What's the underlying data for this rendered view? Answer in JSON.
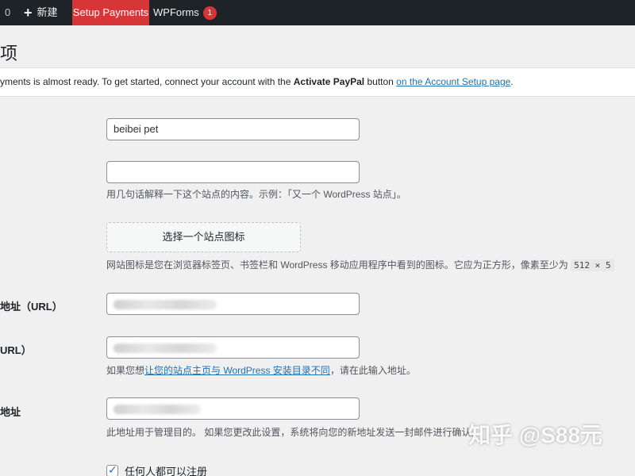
{
  "admin_bar": {
    "comment_count": "0",
    "new_label": "新建",
    "setup_payments_label": "Setup Payments",
    "wpforms_label": "WPForms",
    "wpforms_badge": "1"
  },
  "page": {
    "title": "项"
  },
  "notice": {
    "text_before": "yments is almost ready. To get started, connect your account with the ",
    "bold_text": "Activate PayPal",
    "text_middle": " button ",
    "link_text": "on the Account Setup page",
    "text_end": "."
  },
  "form": {
    "site_title_value": "beibei pet",
    "tagline_value": "",
    "tagline_desc": "用几句话解释一下这个站点的内容。示例：「又一个 WordPress 站点」。",
    "site_icon_button": "选择一个站点图标",
    "site_icon_desc": "网站图标是您在浏览器标签页、书签栏和 WordPress 移动应用程序中看到的图标。它应为正方形，像素至少为 ",
    "site_icon_size": "512 × 5",
    "wp_address_label": "地址（URL）",
    "site_address_label": "URL）",
    "site_address_desc_before": "如果您想",
    "site_address_desc_link": "让您的站点主页与 WordPress 安装目录不同",
    "site_address_desc_after": "，请在此输入地址。",
    "admin_email_label": "地址",
    "admin_email_desc": "此地址用于管理目的。 如果您更改此设置，系统将向您的新地址发送一封邮件进行确认。",
    "membership_checkbox_label": "任何人都可以注册",
    "membership_checked": true
  },
  "watermark": {
    "text": "知乎 @S88元"
  },
  "colors": {
    "admin_bar_bg": "#1d2327",
    "accent_red": "#d63638",
    "link_blue": "#2271b1"
  }
}
